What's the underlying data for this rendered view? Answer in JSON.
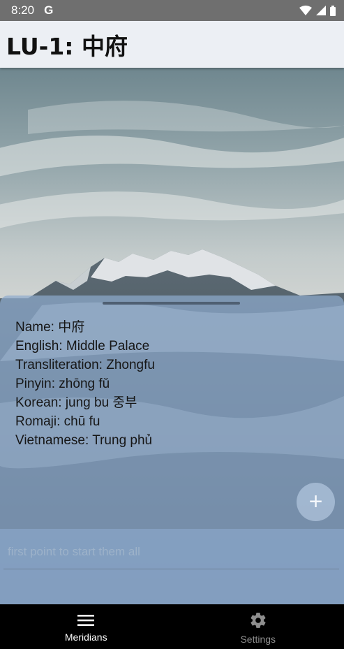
{
  "status_bar": {
    "time": "8:20",
    "g_label": "G"
  },
  "title_bar": {
    "title": "LU-1: 中府"
  },
  "point_info": {
    "name": "Name: 中府",
    "english": "English: Middle Palace",
    "transliteration": "Transliteration: Zhongfu",
    "pinyin": "Pinyin: zhōng fǔ",
    "korean": "Korean: jung bu 중부",
    "romaji": "Romaji: chū fu",
    "vietnamese": "Vietnamese: Trung phủ"
  },
  "fab": {
    "icon": "plus-icon",
    "symbol": "+"
  },
  "notes": {
    "placeholder": "first point to start them all",
    "value": ""
  },
  "bottom_nav": {
    "items": [
      {
        "label": "Meridians",
        "icon": "menu-icon",
        "active": true
      },
      {
        "label": "Settings",
        "icon": "gear-icon",
        "active": false
      }
    ]
  },
  "colors": {
    "sheet": "#8eaacd",
    "nav_bg": "#000000",
    "title_bg": "#eceff4"
  }
}
